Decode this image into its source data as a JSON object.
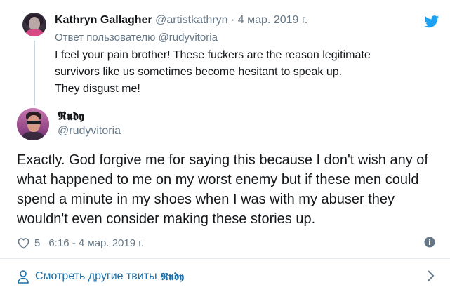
{
  "parent_tweet": {
    "name": "Kathryn Gallagher",
    "handle": "@artistkathryn",
    "separator": "·",
    "date": "4 мар. 2019 г.",
    "reply_to": "Ответ пользователю @rudyvitoria",
    "text_lines": [
      "I feel your pain brother! These fuckers are the reason legitimate",
      "survivors like us sometimes become hesitant to speak up.",
      "They disgust me!"
    ]
  },
  "main_tweet": {
    "name": "𝕽𝖚𝖉𝖞",
    "handle": "@rudyvitoria",
    "text_lines": [
      "Exactly. God forgive me for saying this because I don't wish any of",
      "what happened to me on my worst enemy but if these men could",
      "spend a minute in my shoes when I was with my abuser they",
      "wouldn't even consider making these stories up."
    ],
    "likes": "5",
    "timestamp": "6:16 - 4 мар. 2019 г."
  },
  "footer": {
    "more_tweets_label": "Смотреть другие твиты",
    "more_tweets_name": "𝕽𝖚𝖉𝖞"
  },
  "icons": {
    "brand": "twitter-bird-icon",
    "like": "heart-icon",
    "info": "info-icon",
    "profile": "person-icon",
    "navigate": "chevron-right-icon"
  },
  "colors": {
    "brand_blue": "#1da1f2",
    "link_blue": "#1b6ea8",
    "muted_text": "#657786",
    "text": "#14171a",
    "divider": "#e6ecf0"
  }
}
